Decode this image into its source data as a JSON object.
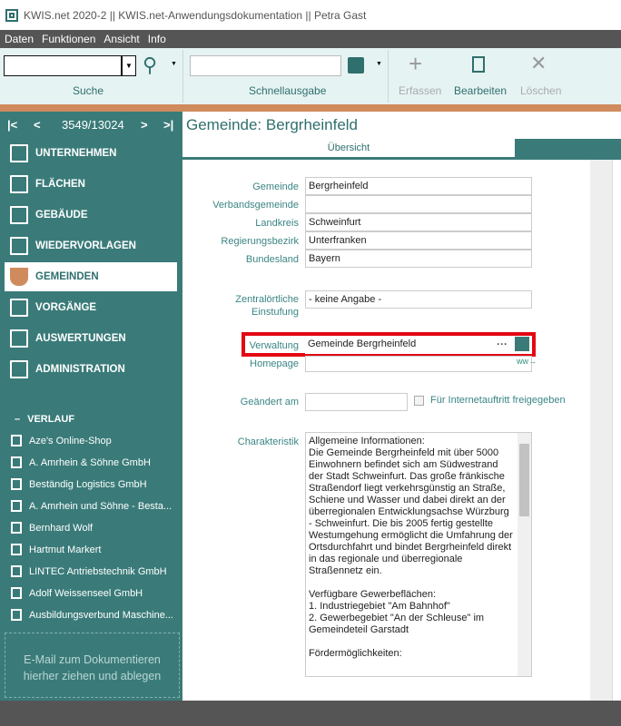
{
  "window": {
    "title": "KWIS.net 2020-2 || KWIS.net-Anwendungsdokumentation || Petra Gast"
  },
  "menu": [
    "Daten",
    "Funktionen",
    "Ansicht",
    "Info"
  ],
  "toolbar": {
    "search_label": "Suche",
    "search_value": "",
    "quick_label": "Schnellausgabe",
    "quick_value": "",
    "create": "Erfassen",
    "edit": "Bearbeiten",
    "delete": "Löschen"
  },
  "nav": {
    "position": "3549/13024"
  },
  "sidebar": {
    "items": [
      "UNTERNEHMEN",
      "FLÄCHEN",
      "GEBÄUDE",
      "WIEDERVORLAGEN",
      "GEMEINDEN",
      "VORGÄNGE",
      "AUSWERTUNGEN",
      "ADMINISTRATION"
    ],
    "history_title": "VERLAUF",
    "history": [
      "Aze's Online-Shop",
      "A. Amrhein & Söhne GmbH",
      "Beständig Logistics GmbH",
      "A. Amrhein und Söhne - Besta...",
      "Bernhard Wolf",
      "Hartmut Markert",
      "LINTEC Antriebstechnik GmbH",
      "Adolf Weissenseel GmbH",
      "Ausbildungsverbund Maschine..."
    ],
    "drop_text": "E-Mail  zum Dokumentieren hierher ziehen und ablegen"
  },
  "main": {
    "title": "Gemeinde: Bergrheinfeld",
    "tab": "Übersicht",
    "fields": {
      "gemeinde_label": "Gemeinde",
      "gemeinde": "Bergrheinfeld",
      "verband_label": "Verbandsgemeinde",
      "verband": "",
      "landkreis_label": "Landkreis",
      "landkreis": "Schweinfurt",
      "bezirk_label": "Regierungsbezirk",
      "bezirk": "Unterfranken",
      "land_label": "Bundesland",
      "land": "Bayern",
      "zentral_label": "Zentralörtliche Einstufung",
      "zentral": "- keine Angabe -",
      "verwaltung_label": "Verwaltung",
      "verwaltung": "Gemeinde Bergrheinfeld",
      "homepage_label": "Homepage",
      "homepage": "",
      "geaendert_label": "Geändert am",
      "geaendert": "",
      "internet_label": "Für Internetauftritt freigegeben",
      "char_label": "Charakteristik",
      "char_text": "Allgemeine Informationen:\nDie Gemeinde Bergrheinfeld mit über 5000 Einwohnern befindet sich am Südwestrand der Stadt Schweinfurt. Das große fränkische Straßendorf liegt verkehrsgünstig an Straße, Schiene und Wasser und dabei direkt an der überregionalen Entwicklungsachse Würzburg - Schweinfurt. Die bis 2005 fertig gestellte Westumgehung ermöglicht die Umfahrung der Ortsdurchfahrt und bindet Bergrheinfeld direkt in das regionale und überregionale Straßennetz ein.\n\nVerfügbare Gewerbeflächen:\n1. Industriegebiet \"Am Bahnhof\"\n2. Gewerbegebiet \"An der Schleuse\" im Gemeindeteil Garstadt\n\nFördermöglichkeiten:"
    }
  }
}
